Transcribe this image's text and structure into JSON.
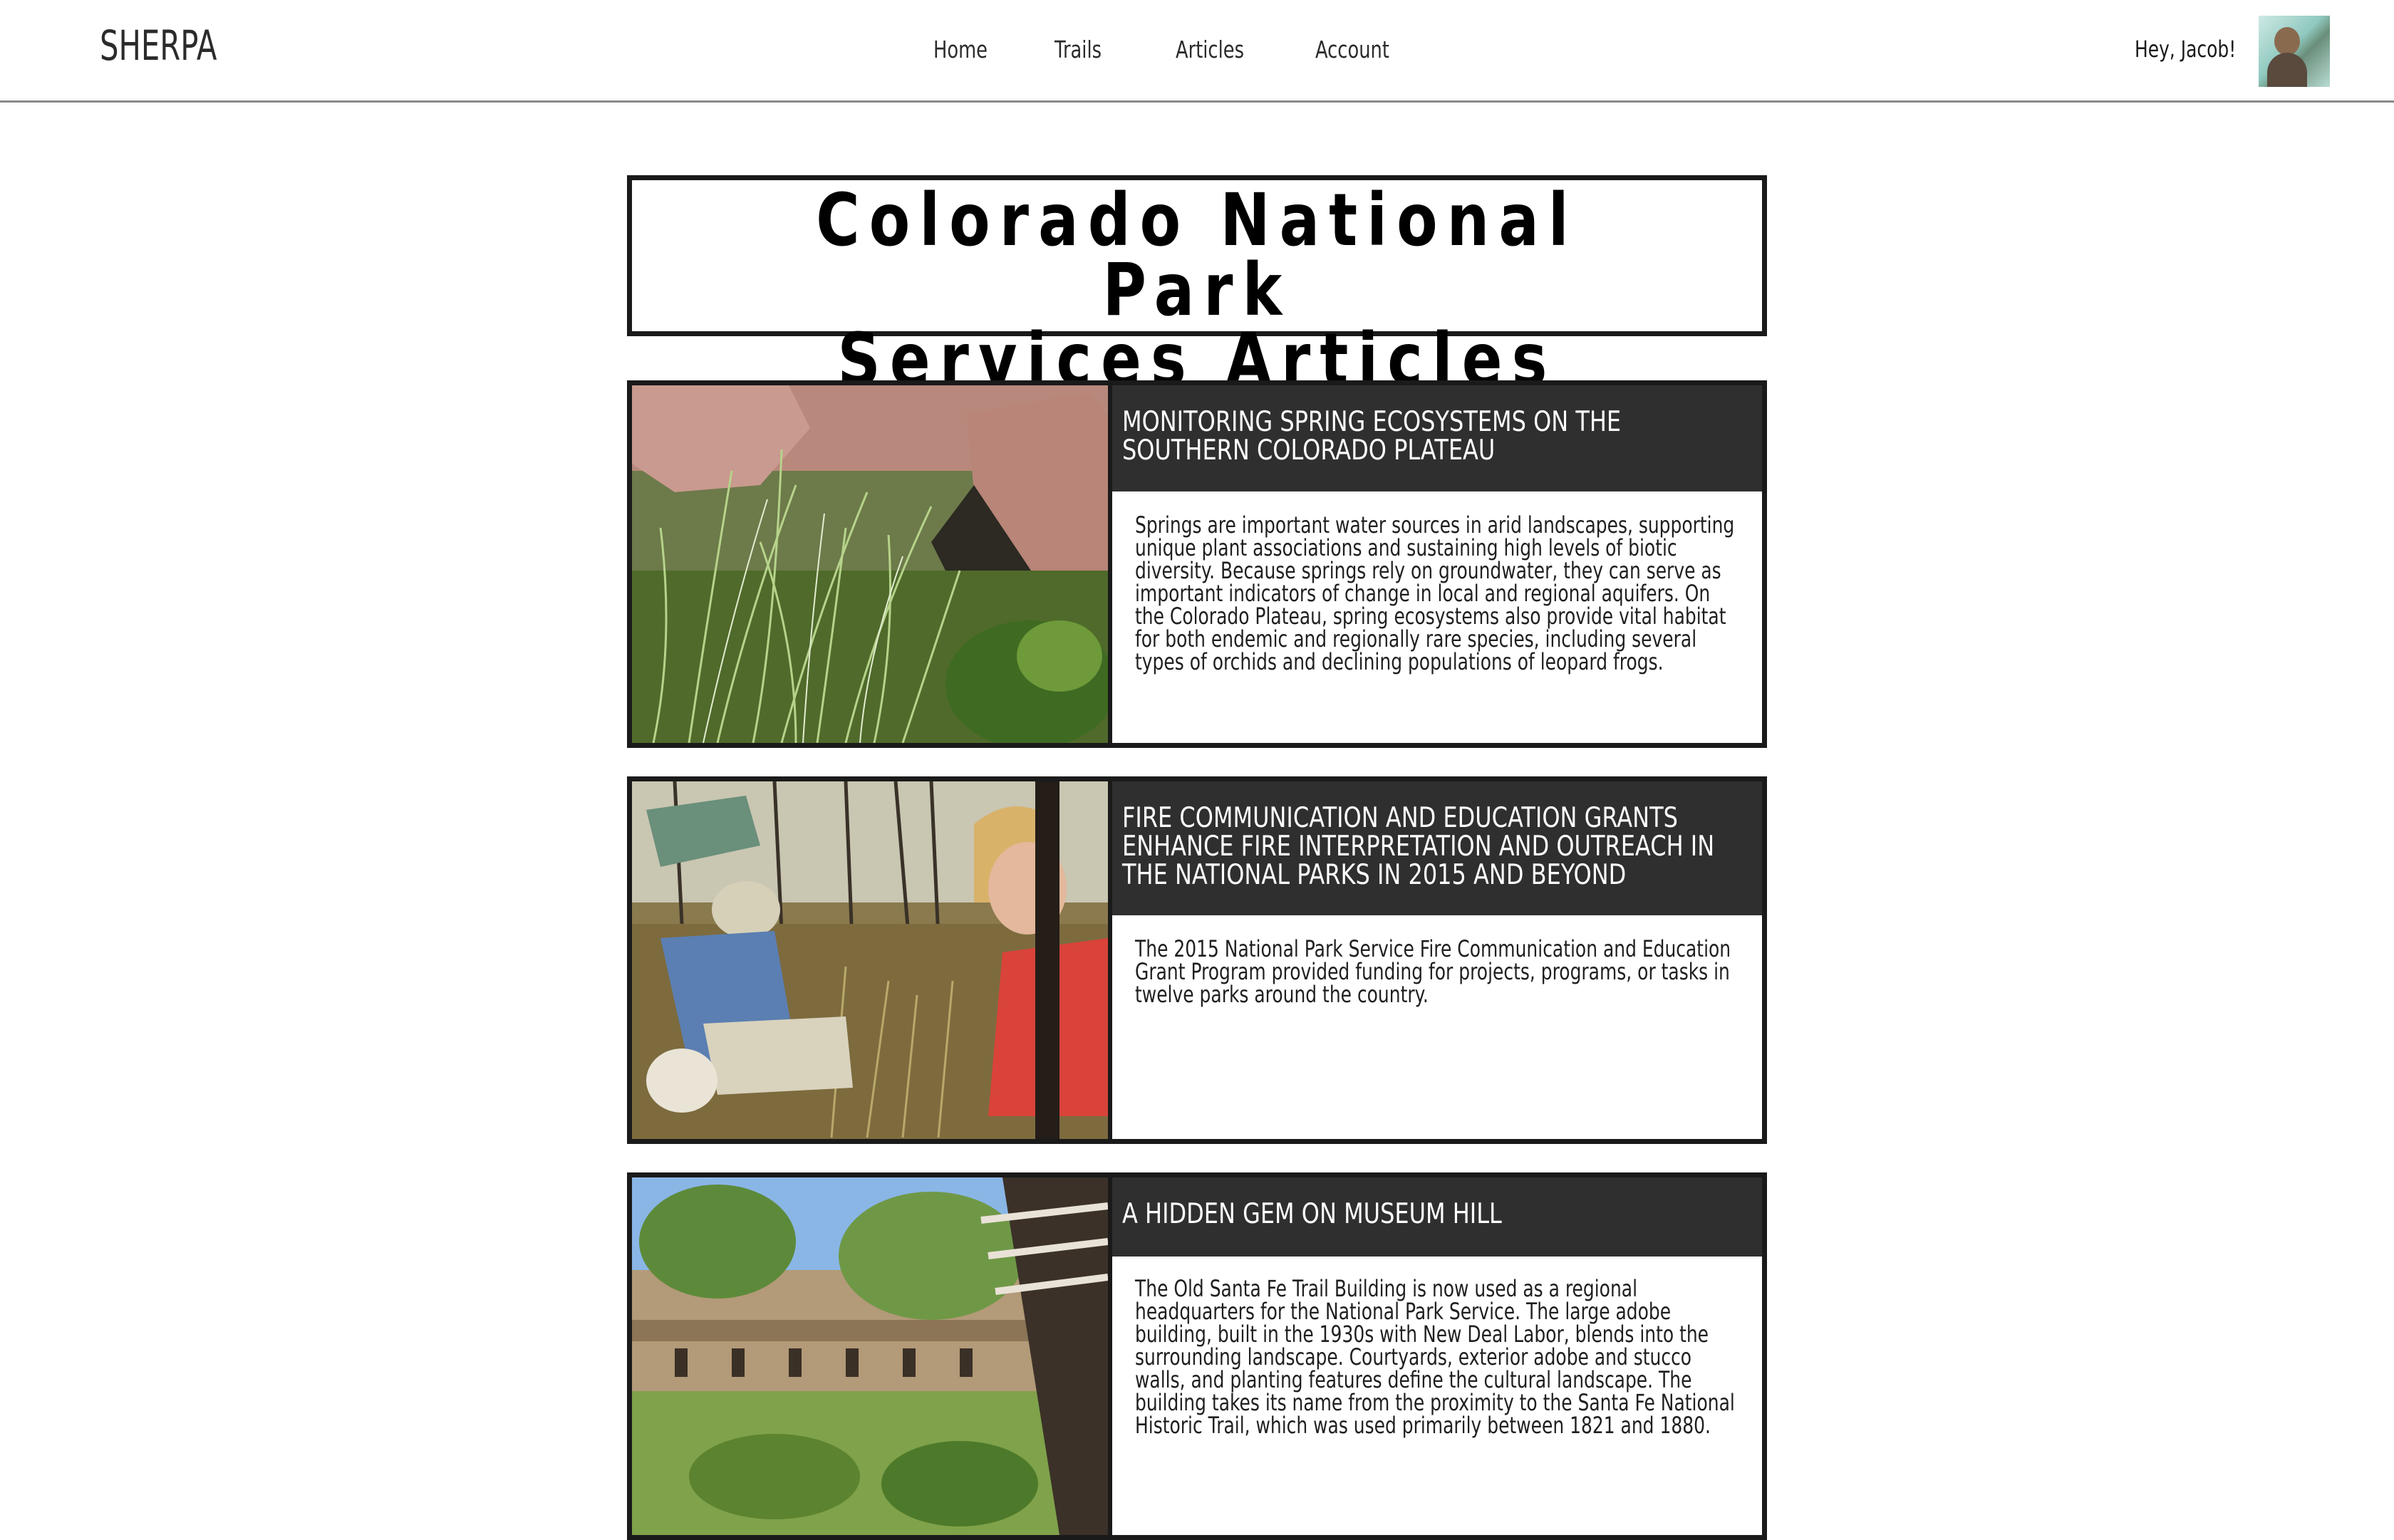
{
  "header": {
    "brand": "SHERPA",
    "nav": [
      {
        "label": "Home"
      },
      {
        "label": "Trails"
      },
      {
        "label": "Articles"
      },
      {
        "label": "Account"
      }
    ],
    "greeting": "Hey, Jacob!",
    "avatar_icon": "user-avatar-photo"
  },
  "page": {
    "title_line1": "Colorado National Park",
    "title_line2": "Services Articles"
  },
  "articles": [
    {
      "title": "MONITORING SPRING ECOSYSTEMS ON THE SOUTHERN COLORADO PLATEAU",
      "summary": "Springs are important water sources in arid landscapes, supporting unique plant associations and sustaining high levels of biotic diversity. Because springs rely on groundwater, they can serve as important indicators of change in local and regional aquifers. On the Colorado Plateau, spring ecosystems also provide vital habitat for both endemic and regionally rare species, including several types of orchids and declining populations of leopard frogs.",
      "image": "spring-grass-rock-photo"
    },
    {
      "title": "FIRE COMMUNICATION AND EDUCATION GRANTS ENHANCE FIRE INTERPRETATION AND OUTREACH IN THE NATIONAL PARKS IN 2015 AND BEYOND",
      "summary": "The 2015 National Park Service Fire Communication and Education Grant Program provided funding for projects, programs, or tasks in twelve parks around the country.",
      "image": "field-researchers-photo"
    },
    {
      "title": "A HIDDEN GEM ON MUSEUM HILL",
      "summary": "The Old Santa Fe Trail Building is now used as a regional headquarters for the National Park Service. The large adobe building, built in the 1930s with New Deal Labor, blends into the surrounding landscape. Courtyards, exterior adobe and stucco walls, and planting features define the cultural landscape. The building takes its name from the proximity to the Santa Fe National Historic Trail, which was used primarily between 1821 and 1880.",
      "image": "adobe-building-courtyard-photo"
    }
  ],
  "colors": {
    "heading_bar": "#2f2f30",
    "border": "#1a1a1a",
    "text": "#1f1f1f"
  }
}
